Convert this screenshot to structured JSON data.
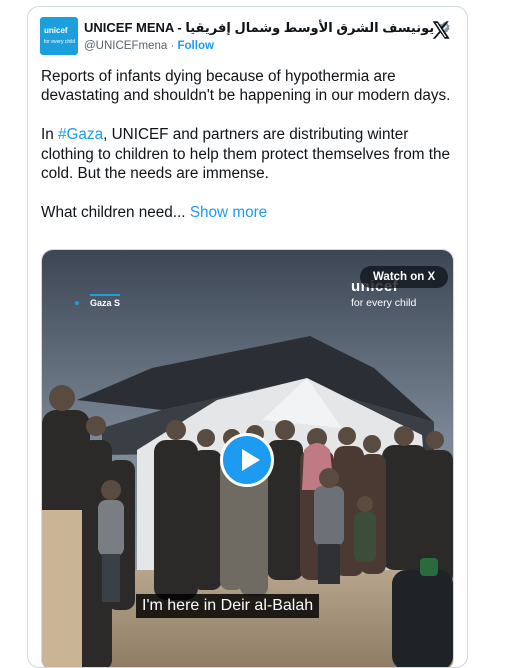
{
  "tweet": {
    "display_name": "UNICEF MENA - يونيسف الشرق الأوسط وشمال إفريقيا",
    "handle": "@UNICEFmena",
    "separator": "·",
    "follow_label": "Follow",
    "avatar_text": "unicef",
    "avatar_subtext": "for every child",
    "paragraphs": {
      "p1": "Reports of infants dying because of hypothermia are devastating and shouldn't be happening in our modern days.",
      "p2_prefix": "In ",
      "p2_hashtag": "#Gaza",
      "p2_rest": ", UNICEF and partners are distributing winter clothing to children to help them protect themselves from the cold. But the needs are immense.",
      "p3": "What children need...",
      "show_more": "Show more"
    }
  },
  "media": {
    "watch_label": "Watch on X",
    "brand_name": "unicef",
    "brand_tagline": "for every child",
    "location_tag": "Gaza S",
    "caption": "I'm here in Deir al-Balah"
  },
  "colors": {
    "accent": "#1d9bf0",
    "unicef_blue": "#1ca0dd",
    "text": "#0f1419",
    "secondary": "#536471"
  },
  "icons": {
    "verified": "verified-badge-icon",
    "x_logo": "x-logo-icon",
    "play": "play-icon"
  }
}
